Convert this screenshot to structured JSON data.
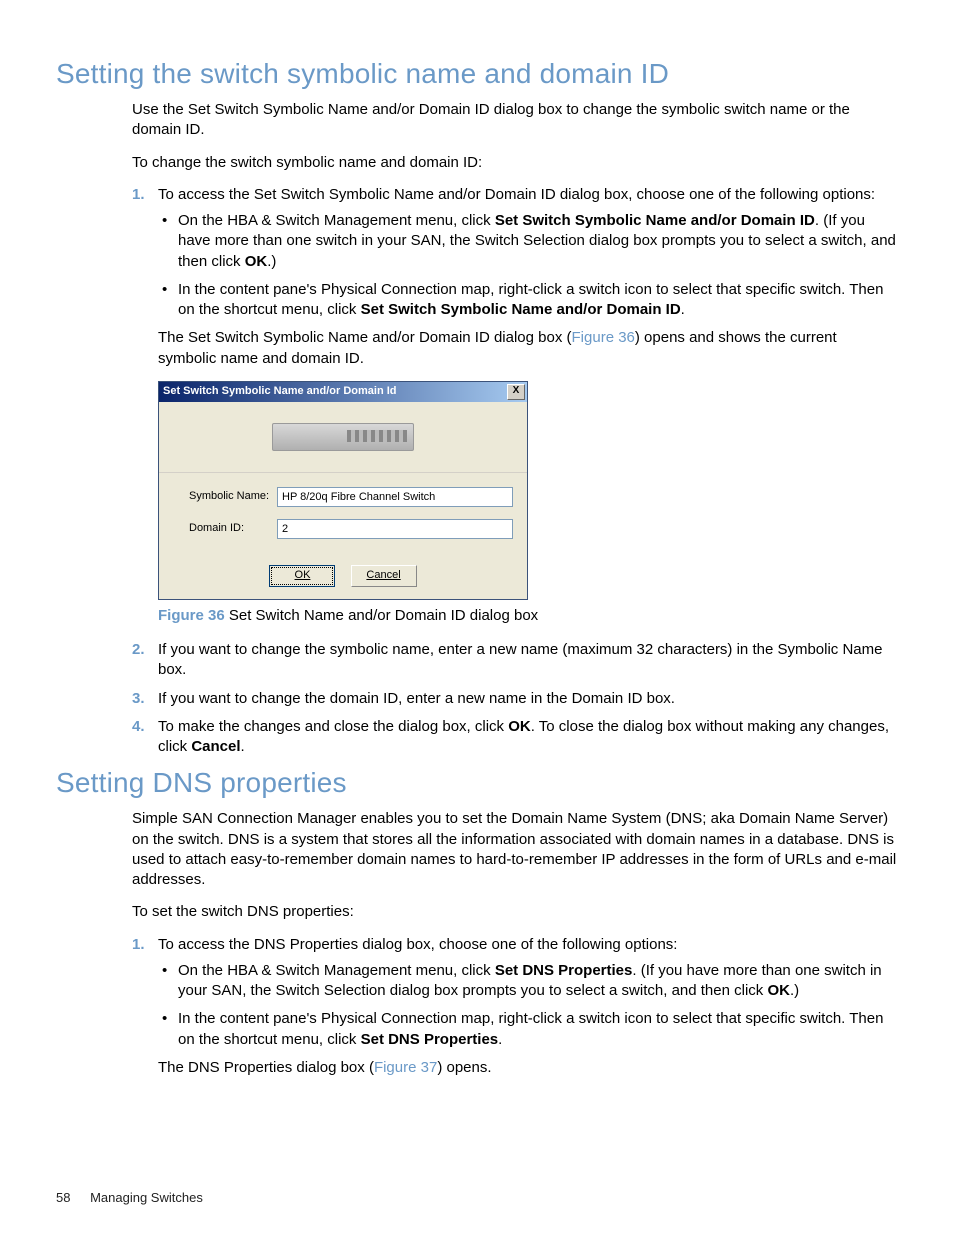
{
  "sec1": {
    "heading": "Setting the switch symbolic name and domain ID",
    "p1": "Use the Set Switch Symbolic Name and/or Domain ID dialog box to change the symbolic switch name or the domain ID.",
    "p2": "To change the switch symbolic name and domain ID:",
    "step1": {
      "num": "1.",
      "text": "To access the Set Switch Symbolic Name and/or Domain ID dialog box, choose one of the following options:",
      "bullets": {
        "b1a": "On the HBA & Switch Management menu, click ",
        "b1b": "Set Switch Symbolic Name and/or Domain ID",
        "b1c": ". (If you have more than one switch in your SAN, the Switch Selection dialog box prompts you to select a switch, and then click ",
        "b1d": "OK",
        "b1e": ".)",
        "b2a": "In the content pane's Physical Connection map, right-click a switch icon to select that specific switch. Then on the shortcut menu, click ",
        "b2b": "Set Switch Symbolic Name and/or Domain ID",
        "b2c": "."
      },
      "after_a": "The Set Switch Symbolic Name and/or Domain ID dialog box (",
      "after_link": "Figure 36",
      "after_b": ") opens and shows the current symbolic name and domain ID."
    },
    "dialog": {
      "title": "Set Switch Symbolic Name and/or Domain Id",
      "close": "X",
      "symbolic_label": "Symbolic Name:",
      "symbolic_value": "HP 8/20q Fibre Channel Switch",
      "domain_label": "Domain ID:",
      "domain_value": "2",
      "ok": "OK",
      "cancel": "Cancel"
    },
    "fig": {
      "label": "Figure 36",
      "text": " Set Switch Name and/or Domain ID dialog box"
    },
    "step2": {
      "num": "2.",
      "text": "If you want to change the symbolic name, enter a new name (maximum 32 characters) in the Symbolic Name box."
    },
    "step3": {
      "num": "3.",
      "text": "If you want to change the domain ID, enter a new name in the Domain ID box."
    },
    "step4": {
      "num": "4.",
      "a": "To make the changes and close the dialog box, click ",
      "ok": "OK",
      "b": ". To close the dialog box without making any changes, click ",
      "cancel": "Cancel",
      "c": "."
    }
  },
  "sec2": {
    "heading": "Setting DNS properties",
    "p1": "Simple SAN Connection Manager enables you to set the Domain Name System (DNS; aka Domain Name Server) on the switch. DNS is a system that stores all the information associated with domain names in a database. DNS is used to attach easy-to-remember domain names to hard-to-remember IP addresses in the form of URLs and e-mail addresses.",
    "p2": "To set the switch DNS properties:",
    "step1": {
      "num": "1.",
      "text": "To access the DNS Properties dialog box, choose one of the following options:",
      "bullets": {
        "b1a": "On the HBA & Switch Management menu, click ",
        "b1b": "Set DNS Properties",
        "b1c": ". (If you have more than one switch in your SAN, the Switch Selection dialog box prompts you to select a switch, and then click ",
        "b1d": "OK",
        "b1e": ".)",
        "b2a": "In the content pane's Physical Connection map, right-click a switch icon to select that specific switch. Then on the shortcut menu, click ",
        "b2b": "Set DNS Properties",
        "b2c": "."
      },
      "after_a": "The DNS Properties dialog box (",
      "after_link": "Figure 37",
      "after_b": ") opens."
    }
  },
  "footer": {
    "page": "58",
    "title": "Managing Switches"
  }
}
